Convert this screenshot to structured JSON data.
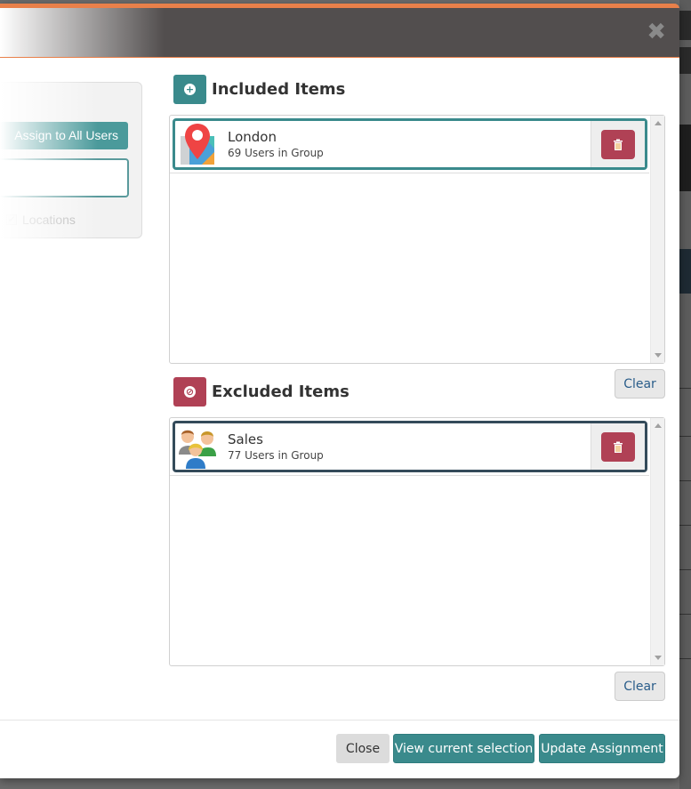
{
  "modal": {
    "close_icon": "close-x-icon"
  },
  "left_panel": {
    "assign_all_label": "Assign to All Users",
    "search_value": "",
    "locations_checkbox_label": "Locations",
    "locations_checked": true
  },
  "included": {
    "title": "Included Items",
    "header_icon": "plus-circle-icon",
    "items": [
      {
        "name": "London",
        "subtitle": "69 Users in Group",
        "icon": "map-pin-icon"
      }
    ],
    "clear_label": "Clear"
  },
  "excluded": {
    "title": "Excluded Items",
    "header_icon": "ban-icon",
    "items": [
      {
        "name": "Sales",
        "subtitle": "77 Users in Group",
        "icon": "group-users-icon"
      }
    ],
    "clear_label": "Clear"
  },
  "footer": {
    "close_label": "Close",
    "view_selection_label": "View current selection",
    "update_label": "Update Assignment"
  },
  "colors": {
    "header_bg": "#524e4e",
    "accent_orange": "#e8804a",
    "teal": "#3a8a8c",
    "danger": "#b04155"
  }
}
